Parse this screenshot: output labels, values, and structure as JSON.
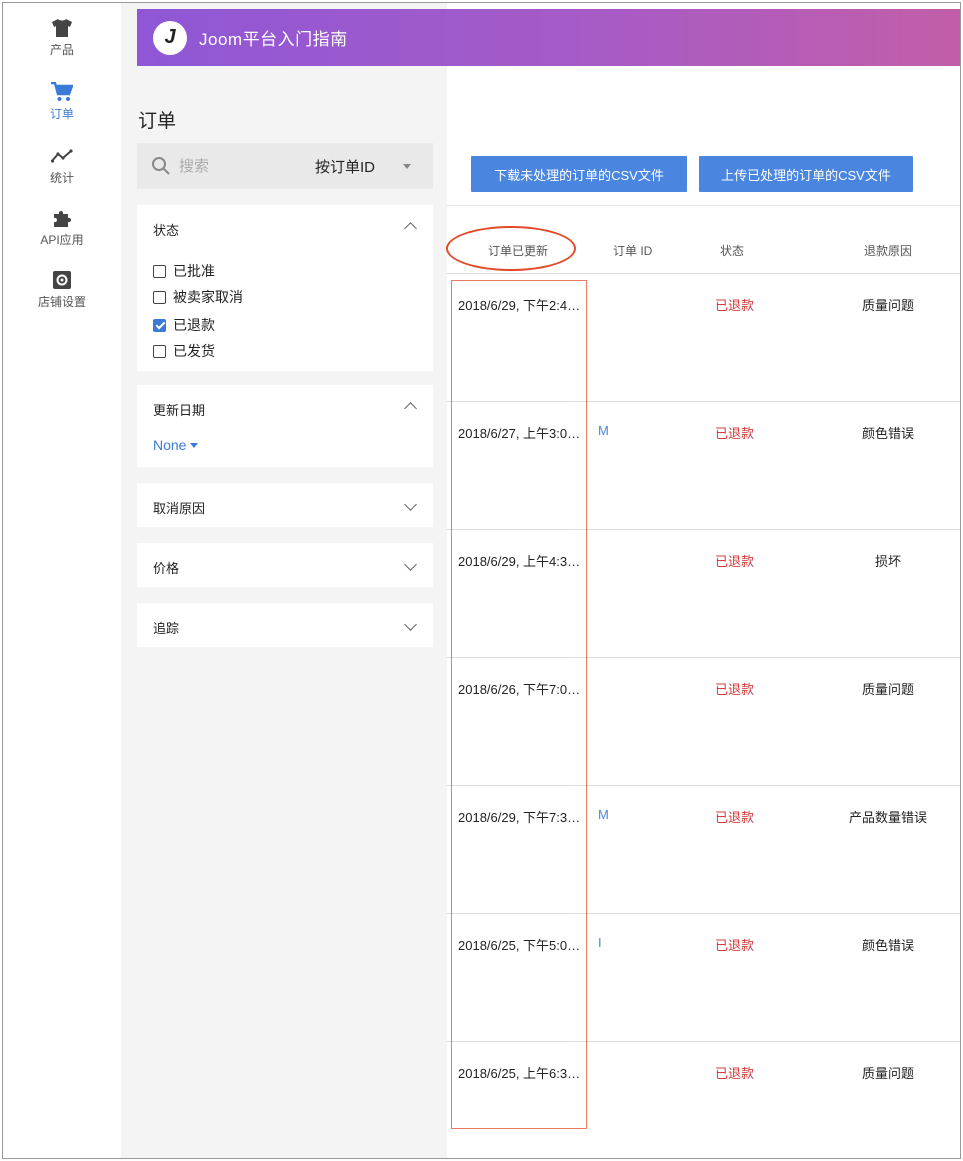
{
  "nav": {
    "items": [
      {
        "label": "产品",
        "icon": "tshirt-icon"
      },
      {
        "label": "订单",
        "icon": "cart-icon"
      },
      {
        "label": "统计",
        "icon": "chart-line-icon"
      },
      {
        "label": "API应用",
        "icon": "puzzle-icon"
      },
      {
        "label": "店铺设置",
        "icon": "settings-icon"
      }
    ],
    "active": "订单"
  },
  "header": {
    "logo_text": "J",
    "title": "Joom平台入门指南"
  },
  "page": {
    "title": "订单"
  },
  "search": {
    "placeholder": "搜索",
    "by": "按订单ID"
  },
  "filters": {
    "status": {
      "title": "状态",
      "options": [
        {
          "label": "已批准",
          "checked": false
        },
        {
          "label": "被卖家取消",
          "checked": false
        },
        {
          "label": "已退款",
          "checked": true
        },
        {
          "label": "已发货",
          "checked": false
        }
      ]
    },
    "update_date": {
      "title": "更新日期",
      "value": "None"
    },
    "cancel_reason": {
      "title": "取消原因"
    },
    "price": {
      "title": "价格"
    },
    "tracking": {
      "title": "追踪"
    }
  },
  "actions": {
    "download": "下载未处理的订单的CSV文件",
    "upload": "上传已处理的订单的CSV文件"
  },
  "table": {
    "headers": [
      "订单已更新",
      "订单 ID",
      "状态",
      "退款原因"
    ],
    "rows": [
      {
        "date": "2018/6/29, 下午2:4…",
        "oid": "",
        "status": "已退款",
        "reason": "质量问题"
      },
      {
        "date": "2018/6/27, 上午3:0…",
        "oid": "M",
        "status": "已退款",
        "reason": "颜色错误"
      },
      {
        "date": "2018/6/29, 上午4:3…",
        "oid": "",
        "status": "已退款",
        "reason": "损坏"
      },
      {
        "date": "2018/6/26, 下午7:0…",
        "oid": "",
        "status": "已退款",
        "reason": "质量问题"
      },
      {
        "date": "2018/6/29, 下午7:3…",
        "oid": "M",
        "status": "已退款",
        "reason": "产品数量错误"
      },
      {
        "date": "2018/6/25, 下午5:0…",
        "oid": "I",
        "status": "已退款",
        "reason": "颜色错误"
      },
      {
        "date": "2018/6/25, 上午6:3…",
        "oid": "",
        "status": "已退款",
        "reason": "质量问题"
      }
    ]
  },
  "colors": {
    "accent": "#4a86e0",
    "refund": "#d43a3a",
    "annotation": "#e14b2a"
  }
}
